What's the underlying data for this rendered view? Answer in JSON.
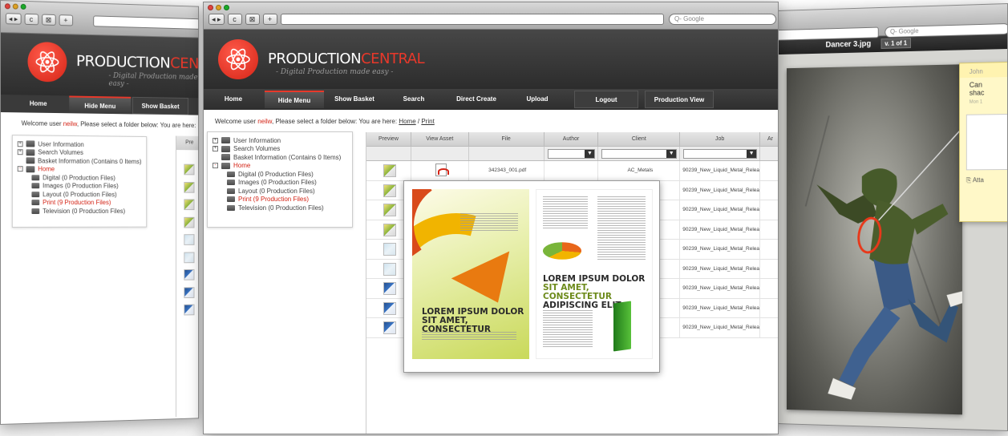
{
  "left_window": {
    "search_placeholder": "",
    "brand_main": "PRODUCTION",
    "brand_accent": "CENTRAL",
    "tagline": "- Digital Production made easy -",
    "nav": [
      "Home",
      "Hide Menu",
      "Show Basket"
    ],
    "welcome_pre": "Welcome user ",
    "welcome_user": "neilw",
    "welcome_post": ", Please select a folder below: You are here:",
    "tree": [
      {
        "label": "User Information",
        "level": 0,
        "expander": "+"
      },
      {
        "label": "Search Volumes",
        "level": 0,
        "expander": "+"
      },
      {
        "label": "Basket Information (Contains 0 Items)",
        "level": 0,
        "expander": ""
      },
      {
        "label": "Home",
        "level": 0,
        "expander": "-"
      },
      {
        "label": "Digital (0 Production Files)",
        "level": 1,
        "expander": ""
      },
      {
        "label": "Images (0 Production Files)",
        "level": 1,
        "expander": ""
      },
      {
        "label": "Layout (0 Production Files)",
        "level": 1,
        "expander": ""
      },
      {
        "label": "Print (9 Production Files)",
        "level": 1,
        "expander": ""
      },
      {
        "label": "Television (0 Production Files)",
        "level": 1,
        "expander": ""
      }
    ],
    "table_header_fragment": "Pre"
  },
  "center_window": {
    "search_placeholder": "Q- Google",
    "brand_main": "PRODUCTION",
    "brand_accent": "CENTRAL",
    "tagline": "- Digital Production made easy -",
    "nav": [
      "Home",
      "Hide Menu",
      "Show Basket",
      "Search",
      "Direct Create",
      "Upload",
      "Logout",
      "Production View"
    ],
    "welcome_pre": "Welcome user ",
    "welcome_user": "neilw",
    "welcome_post": ", Please select a folder below: You are here: ",
    "crumb_home": "Home",
    "crumb_sep": " / ",
    "crumb_print": "Print",
    "tree": [
      {
        "label": "User Information",
        "level": 0,
        "expander": "+"
      },
      {
        "label": "Search Volumes",
        "level": 0,
        "expander": "+"
      },
      {
        "label": "Basket Information (Contains 0 Items)",
        "level": 0,
        "expander": ""
      },
      {
        "label": "Home",
        "level": 0,
        "expander": "-"
      },
      {
        "label": "Digital (0 Production Files)",
        "level": 1,
        "expander": ""
      },
      {
        "label": "Images (0 Production Files)",
        "level": 1,
        "expander": ""
      },
      {
        "label": "Layout (0 Production Files)",
        "level": 1,
        "expander": ""
      },
      {
        "label": "Print (9 Production Files)",
        "level": 1,
        "expander": ""
      },
      {
        "label": "Television (0 Production Files)",
        "level": 1,
        "expander": ""
      }
    ],
    "columns": [
      "Preview",
      "View Asset",
      "File",
      "Author",
      "Client",
      "Job",
      "Ar"
    ],
    "rows": [
      {
        "file": "342343_001.pdf",
        "client": "AC_Metals",
        "job": "90239_New_Liquid_Metal_Release",
        "thumb": "yellow"
      },
      {
        "file": "",
        "client": "",
        "job": "90239_New_Liquid_Metal_Release",
        "thumb": "yellow"
      },
      {
        "file": "",
        "client": "",
        "job": "90239_New_Liquid_Metal_Release",
        "thumb": "yellow"
      },
      {
        "file": "",
        "client": "",
        "job": "90239_New_Liquid_Metal_Release",
        "thumb": "yellow"
      },
      {
        "file": "",
        "client": "",
        "job": "90239_New_Liquid_Metal_Release",
        "thumb": "lite"
      },
      {
        "file": "",
        "client": "",
        "job": "90239_New_Liquid_Metal_Release",
        "thumb": "lite"
      },
      {
        "file": "",
        "client": "",
        "job": "90239_New_Liquid_Metal_Release",
        "thumb": "blue"
      },
      {
        "file": "",
        "client": "",
        "job": "90239_New_Liquid_Metal_Release",
        "thumb": "blue"
      },
      {
        "file": "",
        "client": "",
        "job": "90239_New_Liquid_Metal_Release",
        "thumb": "blue"
      }
    ],
    "brochure": {
      "left_line1": "LOREM IPSUM DOLOR",
      "left_line2": "SIT AMET, CONSECTETUR",
      "right_line1": "LOREM IPSUM DOLOR",
      "right_line2": "SIT AMET, CONSECTETUR",
      "right_line3": "ADIPISCING ELIT"
    }
  },
  "right_window": {
    "search_placeholder": "Q- Google",
    "asset_title": "Dancer 3.jpg",
    "version": "v. 1 of 1",
    "note_author": "John",
    "note_text_1": "Can",
    "note_text_2": "shac",
    "note_date": "Mon 1",
    "attach_label": "Atta"
  },
  "colors": {
    "accent_red": "#e8382a",
    "header_dark": "#2c2c2c",
    "annotation_red": "#e8381a"
  }
}
